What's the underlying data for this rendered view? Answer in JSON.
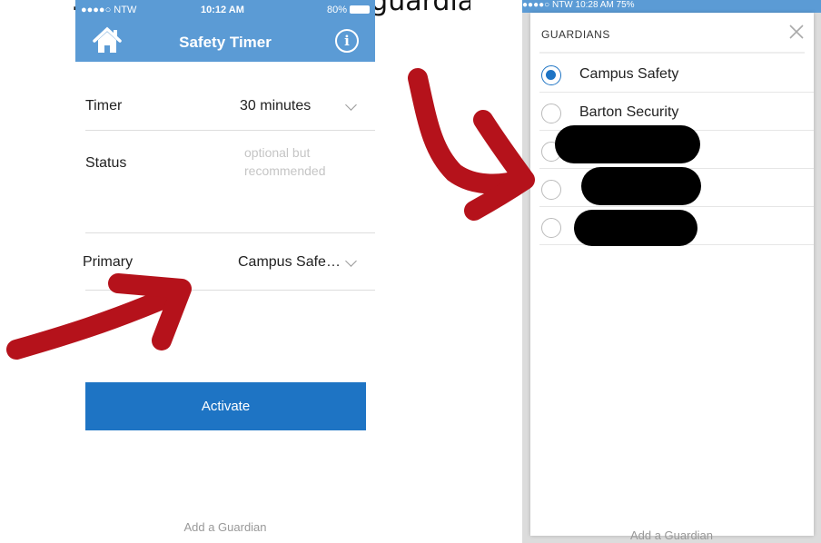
{
  "caption_fragment": "…pdate your primary guardian…",
  "left_screen": {
    "status_bar": {
      "carrier": "●●●●○ NTW",
      "time": "10:12 AM",
      "battery": "80%"
    },
    "nav": {
      "title": "Safety Timer",
      "home_icon": "home-icon",
      "info_icon": "info-icon",
      "info_glyph": "i"
    },
    "timer": {
      "label": "Timer",
      "value": "30 minutes"
    },
    "status": {
      "label": "Status",
      "placeholder": "optional but recommended"
    },
    "primary": {
      "label": "Primary",
      "value": "Campus Safe…"
    },
    "activate_label": "Activate",
    "add_guardian_label": "Add a Guardian"
  },
  "right_screen": {
    "status_bar": "●●●●○ NTW        10:28 AM        75%",
    "modal": {
      "title": "GUARDIANS",
      "close_icon": "close-icon",
      "options": [
        {
          "label": "Campus Safety",
          "selected": true
        },
        {
          "label": "Barton Security",
          "selected": false
        },
        {
          "label": "",
          "selected": false,
          "redacted": true
        },
        {
          "label": "",
          "selected": false,
          "redacted": true
        },
        {
          "label": "",
          "selected": false,
          "redacted": true
        }
      ]
    },
    "footer_label": "Add a Guardian"
  },
  "colors": {
    "nav_blue": "#5b9bd5",
    "button_blue": "#1e74c4",
    "annotation_red": "#b5121b"
  }
}
